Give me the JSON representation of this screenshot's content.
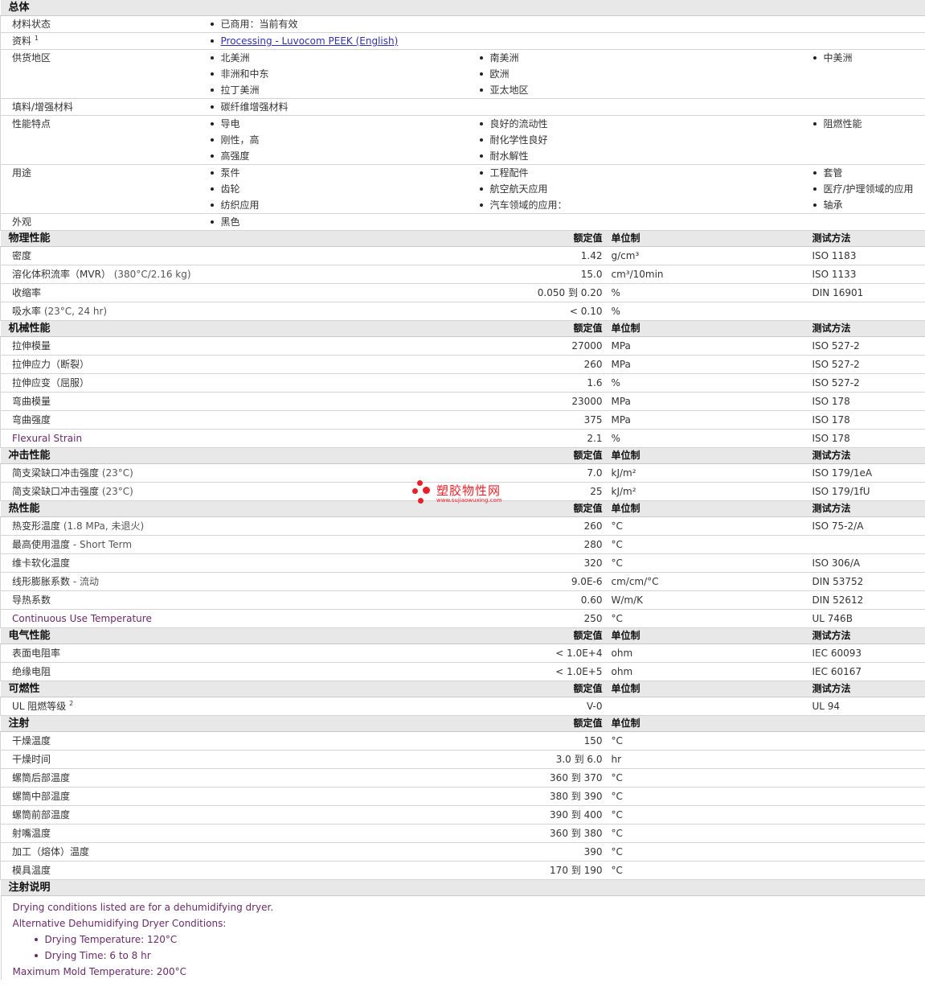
{
  "general": {
    "title": "总体",
    "material_status": {
      "label": "材料状态",
      "value": "已商用：当前有效"
    },
    "literature": {
      "label": "资料",
      "sup": "1",
      "link": "Processing - Luvocom PEEK (English)"
    },
    "availability": {
      "label": "供货地区",
      "items": [
        "北美洲",
        "南美洲",
        "中美洲",
        "非洲和中东",
        "欧洲",
        "拉丁美洲",
        "亚太地区"
      ]
    },
    "filler": {
      "label": "填料/增强材料",
      "value": "碳纤维增强材料"
    },
    "features": {
      "label": "性能特点",
      "items": [
        "导电",
        "良好的流动性",
        "阻燃性能",
        "刚性，高",
        "耐化学性良好",
        "高强度",
        "耐水解性"
      ]
    },
    "uses": {
      "label": "用途",
      "items": [
        "泵件",
        "工程配件",
        "套管",
        "齿轮",
        "航空航天应用",
        "医疗/护理领域的应用",
        "纺织应用",
        "汽车领域的应用：",
        "轴承"
      ]
    },
    "appearance": {
      "label": "外观",
      "value": "黑色"
    }
  },
  "headers": {
    "value": "额定值",
    "unit": "单位制",
    "method": "测试方法"
  },
  "physical": {
    "title": "物理性能",
    "rows": [
      {
        "name": "密度",
        "value": "1.42",
        "unit": "g/cm³",
        "method": "ISO 1183"
      },
      {
        "name": "溶化体积流率（MVR）",
        "cond": "(380°C/2.16 kg)",
        "value": "15.0",
        "unit": "cm³/10min",
        "method": "ISO 1133"
      },
      {
        "name": "收缩率",
        "value": "0.050 到  0.20",
        "unit": "%",
        "method": "DIN 16901"
      },
      {
        "name": "吸水率",
        "cond": "(23°C, 24 hr)",
        "value": "< 0.10",
        "unit": "%",
        "method": ""
      }
    ]
  },
  "mechanical": {
    "title": "机械性能",
    "rows": [
      {
        "name": "拉伸模量",
        "value": "27000",
        "unit": "MPa",
        "method": "ISO 527-2"
      },
      {
        "name": "拉伸应力（断裂）",
        "value": "260",
        "unit": "MPa",
        "method": "ISO 527-2"
      },
      {
        "name": "拉伸应变（屈服）",
        "value": "1.6",
        "unit": "%",
        "method": "ISO 527-2"
      },
      {
        "name": "弯曲模量",
        "value": "23000",
        "unit": "MPa",
        "method": "ISO 178"
      },
      {
        "name": "弯曲强度",
        "value": "375",
        "unit": "MPa",
        "method": "ISO 178"
      },
      {
        "name": "Flexural Strain",
        "value": "2.1",
        "unit": "%",
        "method": "ISO 178"
      }
    ]
  },
  "impact": {
    "title": "冲击性能",
    "rows": [
      {
        "name": "简支梁缺口冲击强度",
        "cond": "(23°C)",
        "value": "7.0",
        "unit": "kJ/m²",
        "method": "ISO 179/1eA"
      },
      {
        "name": "简支梁缺口冲击强度",
        "cond": "(23°C)",
        "value": "25",
        "unit": "kJ/m²",
        "method": "ISO 179/1fU"
      }
    ]
  },
  "thermal": {
    "title": "热性能",
    "rows": [
      {
        "name": "热变形温度",
        "cond": "(1.8 MPa, 未退火)",
        "value": "260",
        "unit": "°C",
        "method": "ISO 75-2/A"
      },
      {
        "name": "最高使用温度",
        "cond": "- Short Term",
        "value": "280",
        "unit": "°C",
        "method": ""
      },
      {
        "name": "维卡软化温度",
        "value": "320",
        "unit": "°C",
        "method": "ISO 306/A"
      },
      {
        "name": "线形膨胀系数",
        "cond": "- 流动",
        "value": "9.0E-6",
        "unit": "cm/cm/°C",
        "method": "DIN 53752"
      },
      {
        "name": "导热系数",
        "value": "0.60",
        "unit": "W/m/K",
        "method": "DIN 52612"
      },
      {
        "name": "Continuous Use Temperature",
        "value": "250",
        "unit": "°C",
        "method": "UL 746B"
      }
    ]
  },
  "electrical": {
    "title": "电气性能",
    "rows": [
      {
        "name": "表面电阻率",
        "value": "< 1.0E+4",
        "unit": "ohm",
        "method": "IEC 60093"
      },
      {
        "name": "绝缘电阻",
        "value": "< 1.0E+5",
        "unit": "ohm",
        "method": "IEC 60167"
      }
    ]
  },
  "flammability": {
    "title": "可燃性",
    "rows": [
      {
        "name": "UL 阻燃等级",
        "sup": "2",
        "value": "V-0",
        "unit": "",
        "method": "UL 94"
      }
    ]
  },
  "injection": {
    "title": "注射",
    "rows": [
      {
        "name": "干燥温度",
        "value": "150",
        "unit": "°C"
      },
      {
        "name": "干燥时间",
        "value": "3.0 到  6.0",
        "unit": "hr"
      },
      {
        "name": "螺筒后部温度",
        "value": "360 到  370",
        "unit": "°C"
      },
      {
        "name": "螺筒中部温度",
        "value": "380 到  390",
        "unit": "°C"
      },
      {
        "name": "螺筒前部温度",
        "value": "390 到  400",
        "unit": "°C"
      },
      {
        "name": "射嘴温度",
        "value": "360 到  380",
        "unit": "°C"
      },
      {
        "name": "加工（熔体）温度",
        "value": "390",
        "unit": "°C"
      },
      {
        "name": "模具温度",
        "value": "170 到  190",
        "unit": "°C"
      }
    ]
  },
  "injection_notes": {
    "title": "注射说明",
    "line1": "Drying conditions listed are for a dehumidifying dryer.",
    "line2": "Alternative Dehumidifying Dryer Conditions:",
    "items": [
      "Drying Temperature: 120°C",
      "Drying Time: 6 to 8 hr"
    ],
    "line3": "Maximum Mold Temperature: 200°C"
  },
  "watermark": {
    "name": "塑胶物性网",
    "url": "www.sujiaowuxing.com",
    "color": "#e8202a"
  }
}
